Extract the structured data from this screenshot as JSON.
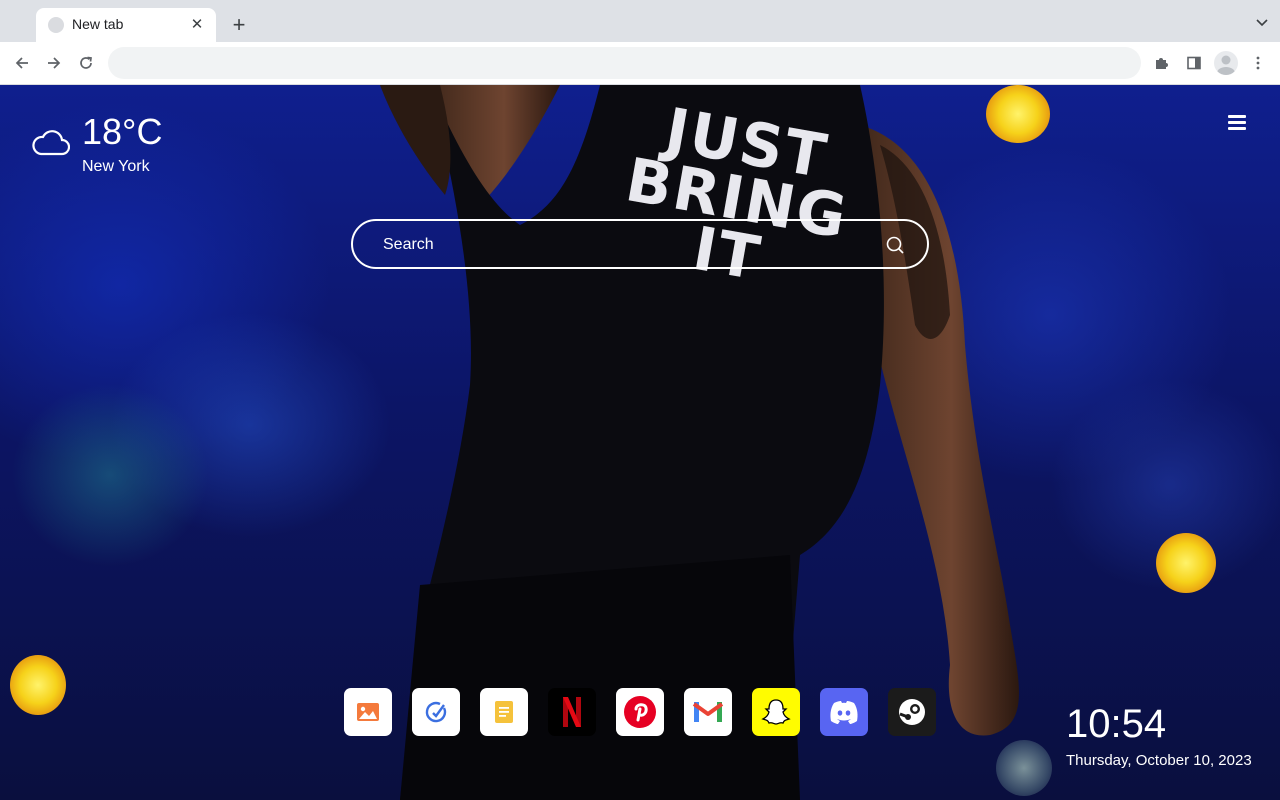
{
  "browser": {
    "tab": {
      "title": "New tab",
      "close_icon": "close-icon",
      "favicon": "default-favicon-icon"
    },
    "new_tab_icon": "plus-icon",
    "tab_search_icon": "chevron-down-icon",
    "toolbar": {
      "back_icon": "arrow-left-icon",
      "forward_icon": "arrow-right-icon",
      "reload_icon": "reload-icon",
      "address_value": "",
      "extensions_icon": "puzzle-icon",
      "side_panel_icon": "side-panel-icon",
      "profile_icon": "avatar-icon",
      "menu_icon": "kebab-menu-icon"
    }
  },
  "newtab": {
    "weather": {
      "icon": "cloud-icon",
      "temperature": "18°C",
      "city": "New York"
    },
    "menu_icon": "hamburger-icon",
    "search": {
      "placeholder": "Search",
      "icon": "search-icon"
    },
    "shortcuts": [
      {
        "name": "photos",
        "icon": "image-icon",
        "bg": "#ffffff"
      },
      {
        "name": "tasks",
        "icon": "check-circle-icon",
        "bg": "#ffffff"
      },
      {
        "name": "notes",
        "icon": "note-icon",
        "bg": "#ffffff"
      },
      {
        "name": "netflix",
        "icon": "netflix-icon",
        "bg": "#000000"
      },
      {
        "name": "pinterest",
        "icon": "pinterest-icon",
        "bg": "#ffffff"
      },
      {
        "name": "gmail",
        "icon": "gmail-icon",
        "bg": "#ffffff"
      },
      {
        "name": "snapchat",
        "icon": "snapchat-icon",
        "bg": "#fffc00"
      },
      {
        "name": "discord",
        "icon": "discord-icon",
        "bg": "#5865f2"
      },
      {
        "name": "steam",
        "icon": "steam-icon",
        "bg": "#1b1b1b"
      }
    ],
    "clock": {
      "time": "10:54",
      "date": "Thursday, October 10, 2023"
    },
    "background_text": [
      "JUST",
      "BRING",
      "IT"
    ]
  }
}
